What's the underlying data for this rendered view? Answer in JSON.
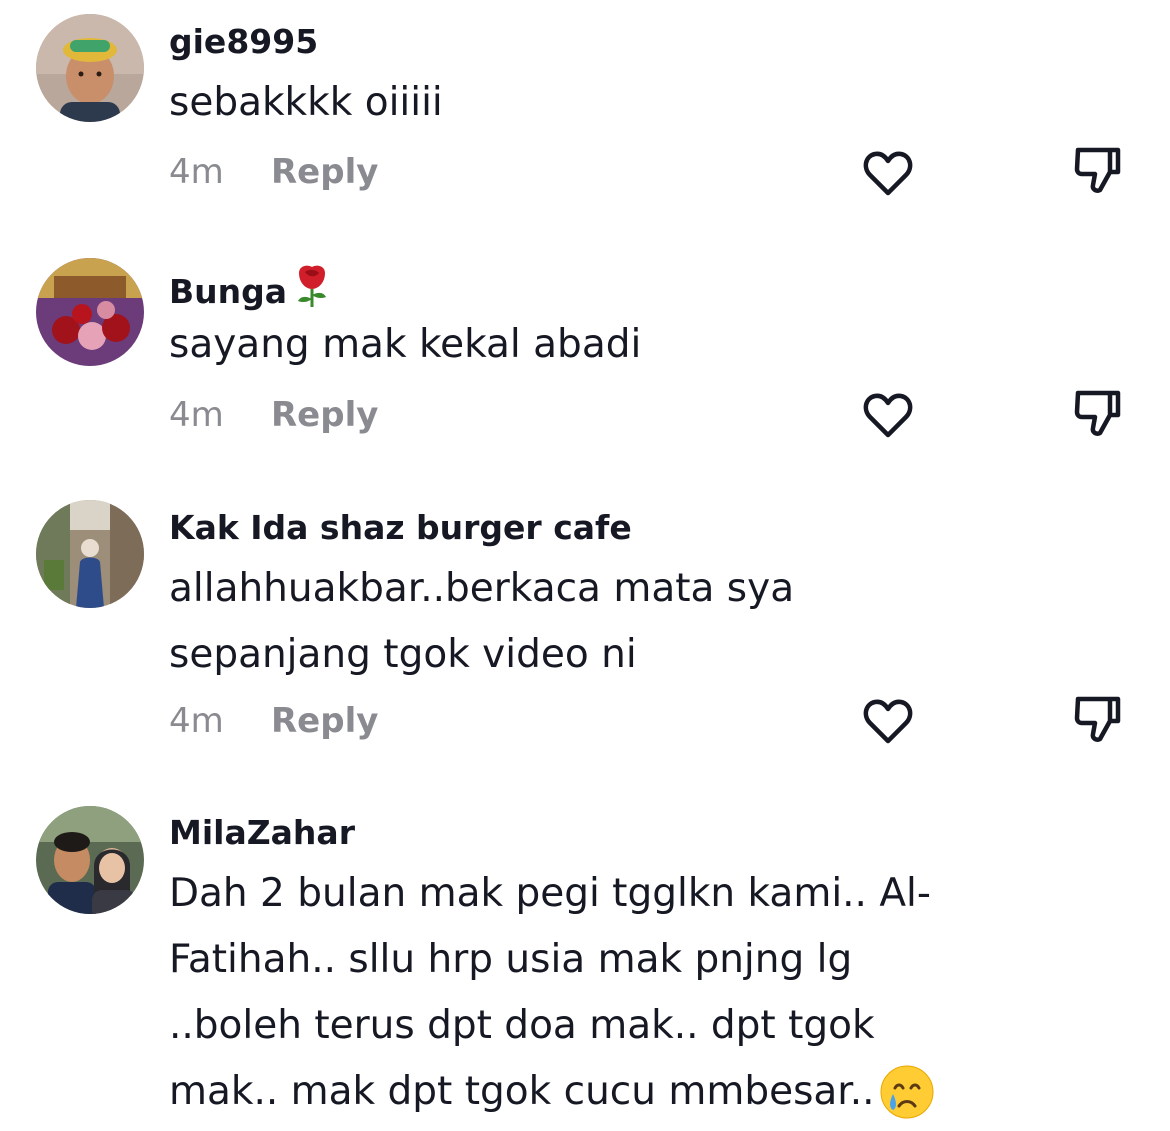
{
  "colors": {
    "text_primary": "#161823",
    "text_secondary": "#8a8b91",
    "icon_stroke": "#161823",
    "background": "#ffffff"
  },
  "comments": [
    {
      "username": "gie8995",
      "text": "sebakkkk oiiiii",
      "time": "4m",
      "reply_label": "Reply",
      "avatar_icon": "user-avatar-man-cap",
      "like_icon": "heart-outline-icon",
      "dislike_icon": "thumbs-down-outline-icon"
    },
    {
      "username": "Bunga",
      "username_emoji": "rose-emoji",
      "text": "sayang mak kekal abadi",
      "time": "4m",
      "reply_label": "Reply",
      "avatar_icon": "user-avatar-flowers",
      "like_icon": "heart-outline-icon",
      "dislike_icon": "thumbs-down-outline-icon"
    },
    {
      "username": "Kak Ida shaz burger cafe",
      "text": "allahhuakbar..berkaca mata sya sepanjang tgok video ni",
      "time": "4m",
      "reply_label": "Reply",
      "avatar_icon": "user-avatar-street",
      "like_icon": "heart-outline-icon",
      "dislike_icon": "thumbs-down-outline-icon"
    },
    {
      "username": "MilaZahar",
      "text": "Dah 2 bulan mak pegi tgglkn kami.. Al-Fatihah.. sllu hrp usia mak pnjng lg ..boleh terus dpt doa mak.. dpt tgok mak.. mak dpt tgok cucu mmbesar..",
      "text_emoji": "crying-face-emoji",
      "avatar_icon": "user-avatar-couple"
    }
  ]
}
